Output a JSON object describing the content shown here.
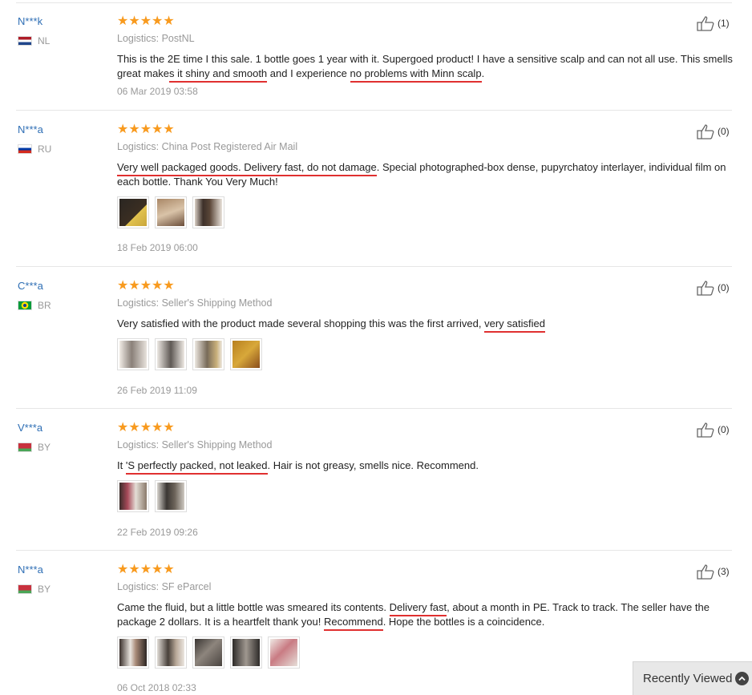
{
  "reviews": [
    {
      "user": "N***k",
      "country": "NL",
      "stars": "★★★★★",
      "logistics": "Logistics: PostNL",
      "text_parts": [
        "This is the 2E time I this sale. 1 bottle goes 1 year with it. Supergoed product! I have a sensitive scalp and can not all use. This smells great make",
        "s it shiny and smooth",
        " and I experience ",
        "no problems with Minn scalp",
        "."
      ],
      "date": "06 Mar 2019 03:58",
      "likes": "(1)"
    },
    {
      "user": "N***a",
      "country": "RU",
      "stars": "★★★★★",
      "logistics": "Logistics: China Post Registered Air Mail",
      "text_parts": [
        "",
        "Very well packaged goods. Delivery fast, do not damage",
        ". Special photographed-box dense, pupyrchatoy interlayer, individual film on each bottle. Thank You Very Much!",
        "",
        ""
      ],
      "date": "18 Feb 2019 06:00",
      "likes": "(0)"
    },
    {
      "user": "C***a",
      "country": "BR",
      "stars": "★★★★★",
      "logistics": "Logistics: Seller's Shipping Method",
      "text_parts": [
        "Very satisfied with the product made several shopping this was the first arrived, ",
        "very satisfied",
        "",
        "",
        ""
      ],
      "date": "26 Feb 2019 11:09",
      "likes": "(0)"
    },
    {
      "user": "V***a",
      "country": "BY",
      "stars": "★★★★★",
      "logistics": "Logistics: Seller's Shipping Method",
      "text_parts": [
        "It ",
        "'S perfectly packed, not leaked",
        ". Hair is not greasy, smells nice. Recommend.",
        "",
        ""
      ],
      "date": "22 Feb 2019 09:26",
      "likes": "(0)"
    },
    {
      "user": "N***a",
      "country": "BY",
      "stars": "★★★★★",
      "logistics": "Logistics: SF eParcel",
      "text_parts": [
        "Came the fluid, but a little bottle was smeared its contents. ",
        "Delivery fast",
        ", about a month in PE. Track to track. The seller have the package 2 dollars. It is a heartfelt thank you! ",
        "Recommend",
        ". Hope the bottles is a coincidence."
      ],
      "date": "06 Oct 2018 02:33",
      "likes": "(3)"
    }
  ],
  "recently_viewed": "Recently Viewed"
}
